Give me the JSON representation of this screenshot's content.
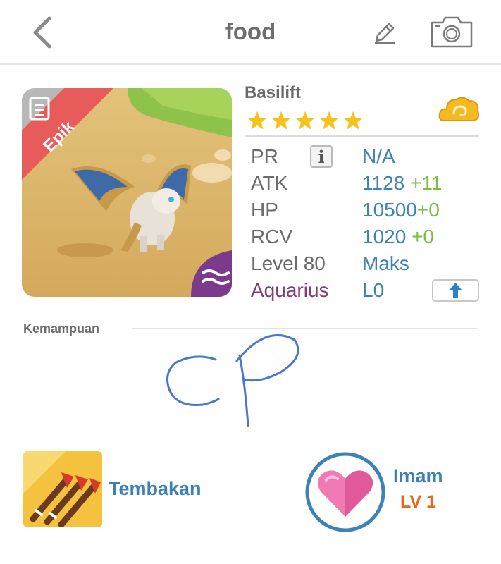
{
  "header": {
    "title": "food"
  },
  "card": {
    "rarity": "Epik",
    "element": "water"
  },
  "monster": {
    "name": "Basilift",
    "stars": 5,
    "stats": [
      {
        "label": "PR",
        "value": "N/A",
        "bonus": ""
      },
      {
        "label": "ATK",
        "value": "1128",
        "bonus": "+11"
      },
      {
        "label": "HP",
        "value": "10500",
        "bonus": "+0"
      },
      {
        "label": "RCV",
        "value": "1020",
        "bonus": "+0"
      },
      {
        "label": "Level 80",
        "value": "Maks",
        "bonus": ""
      }
    ],
    "constellation": {
      "label": "Aquarius",
      "value": "L0"
    }
  },
  "abilities": {
    "section_label": "Kemampuan",
    "skill_name": "Tembakan",
    "leader_name": "Imam",
    "leader_level": "LV 1"
  },
  "colors": {
    "accent_blue": "#3a82b8",
    "bonus_green": "#76c043",
    "constellation_purple": "#7e3c78",
    "rarity_red": "#e85b5b",
    "level_orange": "#e8651a"
  },
  "icons": {
    "back": "chevron-left-icon",
    "edit": "pencil-icon",
    "camera": "camera-icon",
    "info": "info-icon",
    "upgrade": "arrow-up-icon",
    "element": "cloud-element-icon",
    "skill": "triple-arrow-icon",
    "leader": "heart-icon"
  }
}
